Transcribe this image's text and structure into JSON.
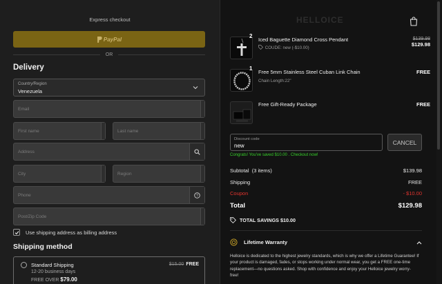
{
  "checkout": {
    "express_label": "Express checkout",
    "paypal_label": "PayPal",
    "or_label": "OR",
    "delivery_title": "Delivery",
    "country": {
      "label": "Country/Region",
      "value": "Venezuela"
    },
    "placeholders": {
      "email": "Email",
      "first_name": "First name",
      "last_name": "Last name",
      "address": "Address",
      "city": "City",
      "region": "Region",
      "phone": "Phone",
      "postal": "Post/Zip Code"
    },
    "billing_checkbox_label": "Use shipping address as billing address",
    "shipping_method_title": "Shipping method",
    "shipping_option": {
      "name": "Standard Shipping",
      "days": "12-20 business days",
      "over_label": "FREE OVER",
      "over_amount": "$79.00",
      "old_price": "$15.00",
      "price": "FREE"
    }
  },
  "summary": {
    "logo_text": "HELLOICE",
    "items": [
      {
        "qty": "2",
        "title": "Iced Baguette Diamond Cross Pendant",
        "sub": "COUDE: new (-$10.00)",
        "old_price": "$139.98",
        "price": "$129.98"
      },
      {
        "qty": "1",
        "title": "Free 5mm Stainless Steel Cuban Link Chain",
        "sub": "Chain Length:22\"",
        "price": "FREE"
      },
      {
        "qty": "",
        "title": "Free Gift-Ready Package",
        "sub": "",
        "price": "FREE"
      }
    ],
    "discount": {
      "label": "Discount code",
      "value": "new",
      "cancel_label": "CANCEL"
    },
    "congrats": "Congrats! You've saved $10.00 . Checkout now!",
    "subtotal_label": "Subtotal",
    "subtotal_count": "(3 items)",
    "subtotal_value": "$139.98",
    "shipping_label": "Shipping",
    "shipping_value": "FREE",
    "coupon_label": "Coupon",
    "coupon_value": "- $10.00",
    "total_label": "Total",
    "total_value": "$129.98",
    "savings_label": "TOTAL SAVINGS $10.00",
    "warranty_title": "Lifetime Warranty",
    "warranty_body": "Helloice is dedicated to the highest jewelry standards, which is why we offer a Lifetime Guarantee! If your product is damaged, fades, or stops working under normal wear, you get a FREE one-time replacement—no questions asked. Shop with confidence and enjoy your Helloice jewelry worry-free!"
  },
  "colors": {
    "paypal_button": "#7a6414",
    "success_text": "#38d12b",
    "coupon_red": "#e0342e"
  }
}
